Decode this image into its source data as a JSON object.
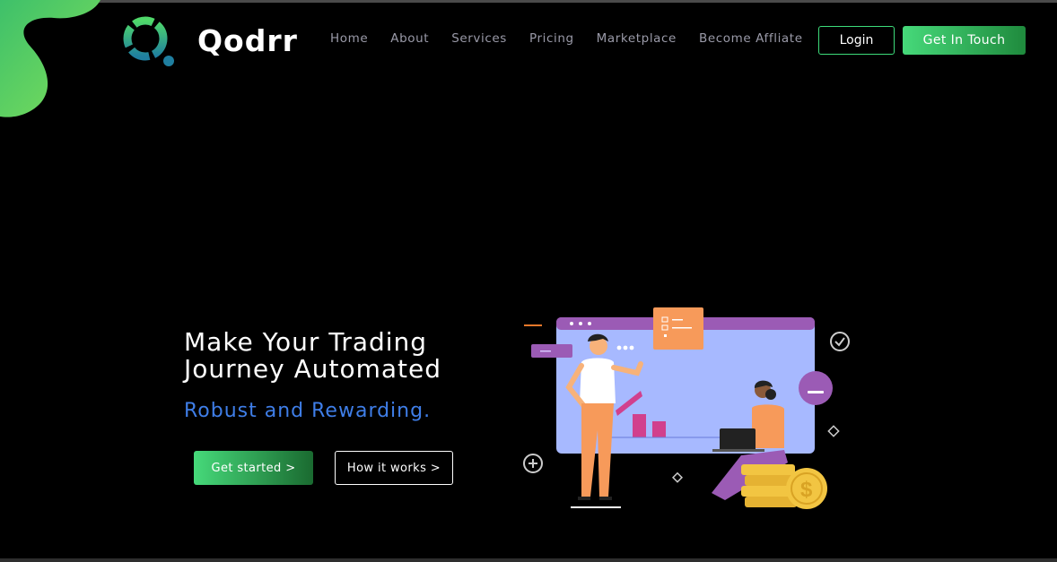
{
  "brand": {
    "name": "Qodrr"
  },
  "nav": {
    "items": [
      {
        "label": "Home"
      },
      {
        "label": "About"
      },
      {
        "label": "Services"
      },
      {
        "label": "Pricing"
      },
      {
        "label": "Marketplace"
      },
      {
        "label": "Become Affliate"
      }
    ],
    "login_label": "Login",
    "contact_label": "Get In Touch"
  },
  "hero": {
    "title_line1": "Make Your Trading",
    "title_line2": "Journey Automated",
    "subtitle": "Robust and Rewarding.",
    "primary_cta": "Get started >",
    "secondary_cta": "How it works >"
  },
  "colors": {
    "accent_green": "#3ddb7a",
    "subtitle_blue": "#3f7ee8",
    "nav_text": "#9a9aa8",
    "background": "#000000"
  }
}
